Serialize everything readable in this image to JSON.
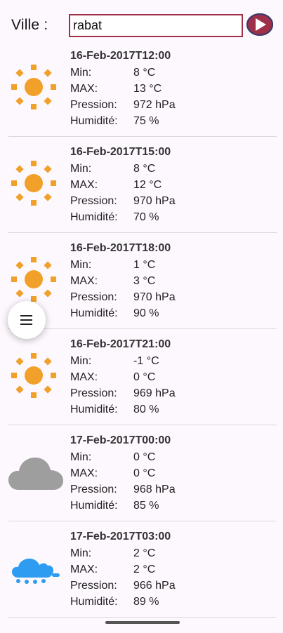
{
  "header": {
    "city_label": "Ville :",
    "city_value": "rabat",
    "go_button_icon": "play-icon",
    "go_button_color": "#a0304a",
    "go_button_border_color": "#3a3a6a"
  },
  "menu_button_icon": "menu-icon",
  "colors": {
    "sun": "#f1a02a",
    "cloud": "#9e9e9e",
    "rain_cloud": "#2e9cf0"
  },
  "forecasts": [
    {
      "date": "16-Feb-2017T12:00",
      "icon": "sun-icon",
      "min_label": "Min:",
      "min": "8 °C",
      "max_label": "MAX:",
      "max": "13 °C",
      "pressure_label": "Pression:",
      "pressure": "972 hPa",
      "humidity_label": "Humidité:",
      "humidity": "75 %"
    },
    {
      "date": "16-Feb-2017T15:00",
      "icon": "sun-icon",
      "min_label": "Min:",
      "min": "8 °C",
      "max_label": "MAX:",
      "max": "12 °C",
      "pressure_label": "Pression:",
      "pressure": "970 hPa",
      "humidity_label": "Humidité:",
      "humidity": "70 %"
    },
    {
      "date": "16-Feb-2017T18:00",
      "icon": "sun-icon",
      "min_label": "Min:",
      "min": "1 °C",
      "max_label": "MAX:",
      "max": "3 °C",
      "pressure_label": "Pression:",
      "pressure": "970 hPa",
      "humidity_label": "Humidité:",
      "humidity": "90 %"
    },
    {
      "date": "16-Feb-2017T21:00",
      "icon": "sun-icon",
      "min_label": "Min:",
      "min": "-1 °C",
      "max_label": "MAX:",
      "max": "0 °C",
      "pressure_label": "Pression:",
      "pressure": "969 hPa",
      "humidity_label": "Humidité:",
      "humidity": "80 %"
    },
    {
      "date": "17-Feb-2017T00:00",
      "icon": "cloud-icon",
      "min_label": "Min:",
      "min": "0 °C",
      "max_label": "MAX:",
      "max": "0 °C",
      "pressure_label": "Pression:",
      "pressure": "968 hPa",
      "humidity_label": "Humidité:",
      "humidity": "85 %"
    },
    {
      "date": "17-Feb-2017T03:00",
      "icon": "rain-cloud-icon",
      "min_label": "Min:",
      "min": "2 °C",
      "max_label": "MAX:",
      "max": "2 °C",
      "pressure_label": "Pression:",
      "pressure": "966 hPa",
      "humidity_label": "Humidité:",
      "humidity": "89 %"
    }
  ]
}
